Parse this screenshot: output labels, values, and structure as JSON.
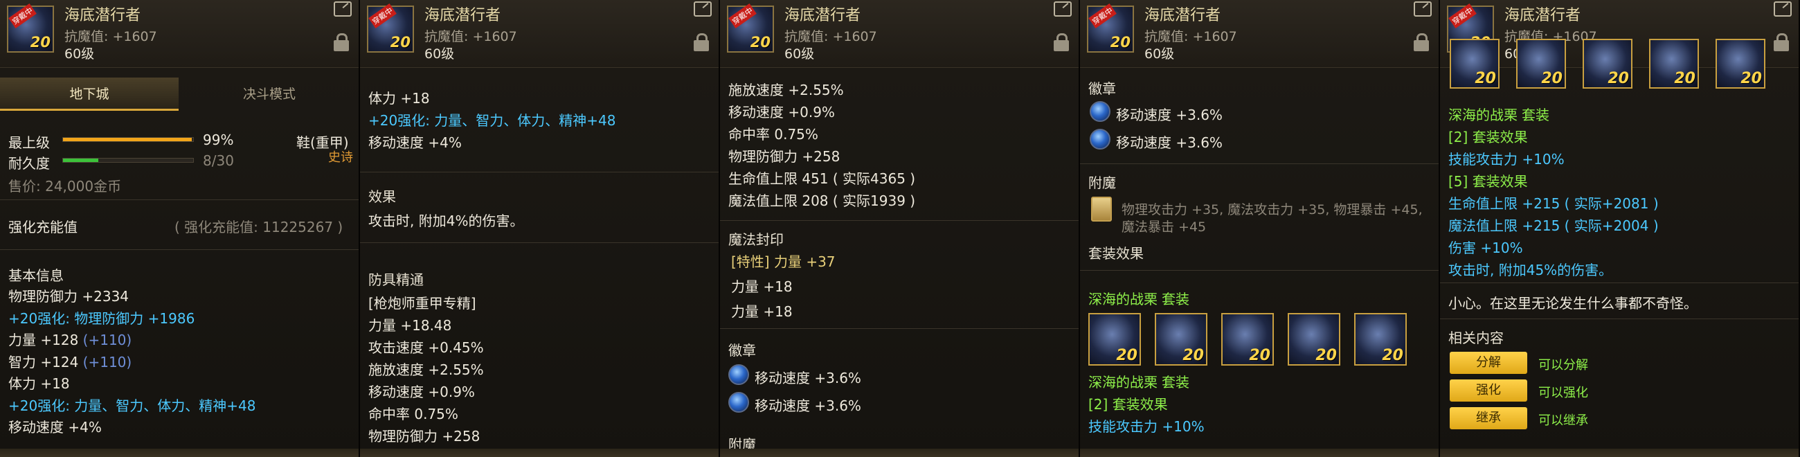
{
  "item": {
    "name": "海底潜行者",
    "stat_line": "抗魔值: +1607",
    "level": "60级",
    "icon_tag": "穿戴中",
    "icon_level": "20"
  },
  "panel1": {
    "tabs": [
      "地下城",
      "决斗模式"
    ],
    "grade_label": "最上级",
    "grade_value": "99%",
    "grade_fill": 0.99,
    "durability_label": "耐久度",
    "durability_value": "8/30",
    "durability_fill": 0.27,
    "slot_type": "鞋(重甲)",
    "rarity": "史诗",
    "price": "售价: 24,000金币",
    "reinforce_label": "强化充能值",
    "reinforce_value": "( 强化充能值: 11225267 )",
    "basic_info": "基本信息",
    "lines": [
      {
        "text": "物理防御力 +2334",
        "cls": "white"
      },
      {
        "text": "+20强化: 物理防御力 +1986",
        "cls": "cyan"
      },
      {
        "text": "力量 +128",
        "extra": "(+110)",
        "cls": "white"
      },
      {
        "text": "智力 +124",
        "extra": "(+110)",
        "cls": "white"
      },
      {
        "text": "体力 +18",
        "cls": "white"
      },
      {
        "text": "+20强化: 力量、智力、体力、精神+48",
        "cls": "cyan"
      },
      {
        "text": "移动速度 +4%",
        "cls": "white"
      }
    ]
  },
  "panel2": {
    "top_lines": [
      {
        "text": "体力 +18",
        "cls": "white"
      },
      {
        "text": "+20强化: 力量、智力、体力、精神+48",
        "cls": "cyan"
      },
      {
        "text": "移动速度 +4%",
        "cls": "white"
      }
    ],
    "effect_title": "效果",
    "effect_text": "攻击时, 附加4%的伤害。",
    "mastery_title": "防具精通",
    "mastery_lines": [
      {
        "text": "[枪炮师重甲专精]",
        "cls": "white"
      },
      {
        "text": "力量 +18.48",
        "cls": "white"
      },
      {
        "text": "攻击速度 +0.45%",
        "cls": "white"
      },
      {
        "text": "施放速度 +2.55%",
        "cls": "white"
      },
      {
        "text": "移动速度 +0.9%",
        "cls": "white"
      },
      {
        "text": "命中率 0.75%",
        "cls": "white"
      },
      {
        "text": "物理防御力 +258",
        "cls": "white"
      }
    ]
  },
  "panel3": {
    "top_lines": [
      {
        "text": "施放速度 +2.55%",
        "cls": "white"
      },
      {
        "text": "移动速度 +0.9%",
        "cls": "white"
      },
      {
        "text": "命中率 0.75%",
        "cls": "white"
      },
      {
        "text": "物理防御力 +258",
        "cls": "white"
      },
      {
        "text": "生命值上限 451 ( 实际4365 )",
        "cls": "white"
      },
      {
        "text": "魔法值上限 208 ( 实际1939 )",
        "cls": "white"
      }
    ],
    "seal_title": "魔法封印",
    "seal_lines": [
      {
        "text": "[特性] 力量 +37",
        "cls": "gold"
      },
      {
        "text": "力量 +18",
        "cls": "white"
      },
      {
        "text": "力量 +18",
        "cls": "white"
      }
    ],
    "emblem_title": "徽章",
    "emblem_lines": [
      "移动速度 +3.6%",
      "移动速度 +3.6%"
    ],
    "enchant_partial": "附魔"
  },
  "panel4": {
    "emblem_title": "徽章",
    "emblem_lines": [
      "移动速度 +3.6%",
      "移动速度 +3.6%"
    ],
    "enchant_title": "附魔",
    "enchant_text_1": "物理攻击力 +35, 魔法攻击力 +35, 物理暴击 +45,",
    "enchant_text_2": "魔法暴击 +45",
    "set_effect_title": "套装效果",
    "set_name": "深海的战栗",
    "set_suffix": "套装",
    "set_name_2": "深海的战栗",
    "set_suffix_2": "套装",
    "set_bonus_2": "[2] 套装效果",
    "set_bonus_2_line": "技能攻击力 +10%"
  },
  "panel5": {
    "set_name": "深海的战栗",
    "set_suffix": "套装",
    "bonus_lines": [
      {
        "text": "[2] 套装效果",
        "cls": "green"
      },
      {
        "text": "技能攻击力 +10%",
        "cls": "cyan"
      },
      {
        "text": "[5] 套装效果",
        "cls": "green"
      },
      {
        "text": "生命值上限 +215 ( 实际+2081 )",
        "cls": "cyan"
      },
      {
        "text": "魔法值上限 +215 ( 实际+2004 )",
        "cls": "cyan"
      },
      {
        "text": "伤害 +10%",
        "cls": "cyan"
      },
      {
        "text": "攻击时, 附加45%的伤害。",
        "cls": "cyan"
      }
    ],
    "flavor": "小心。在这里无论发生什么事都不奇怪。",
    "related_title": "相关内容",
    "actions": [
      {
        "label": "分解",
        "note": "可以分解"
      },
      {
        "label": "强化",
        "note": "可以强化"
      },
      {
        "label": "继承",
        "note": "可以继承"
      }
    ]
  }
}
